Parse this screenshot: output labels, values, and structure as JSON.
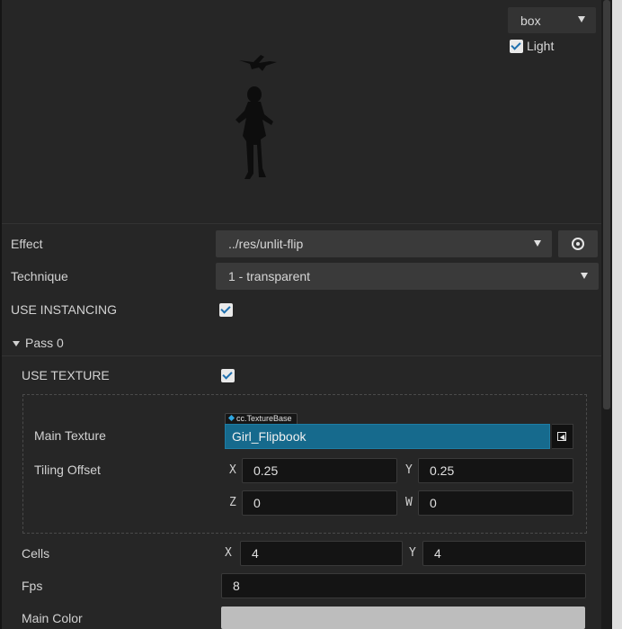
{
  "preview": {
    "mesh_select": "box",
    "light_label": "Light",
    "light_checked": true
  },
  "properties": {
    "effect": {
      "label": "Effect",
      "value": "../res/unlit-flip"
    },
    "technique": {
      "label": "Technique",
      "value": "1 - transparent"
    },
    "use_instancing": {
      "label": "USE INSTANCING",
      "checked": true
    }
  },
  "pass": {
    "title": "Pass 0",
    "use_texture": {
      "label": "USE TEXTURE",
      "checked": true
    },
    "main_texture": {
      "label": "Main Texture",
      "type_tag": "cc.TextureBase",
      "value": "Girl_Flipbook"
    },
    "tiling_offset": {
      "label": "Tiling Offset",
      "x_axis": "X",
      "x": "0.25",
      "y_axis": "Y",
      "y": "0.25",
      "z_axis": "Z",
      "z": "0",
      "w_axis": "W",
      "w": "0"
    },
    "cells": {
      "label": "Cells",
      "x_axis": "X",
      "x": "4",
      "y_axis": "Y",
      "y": "4"
    },
    "fps": {
      "label": "Fps",
      "value": "8"
    },
    "main_color": {
      "label": "Main Color",
      "color": "#bdbdbd"
    }
  },
  "icons": {
    "locate": "locate-icon",
    "asset_pick": "asset-pick-icon",
    "collapse": "triangle-down-icon"
  }
}
